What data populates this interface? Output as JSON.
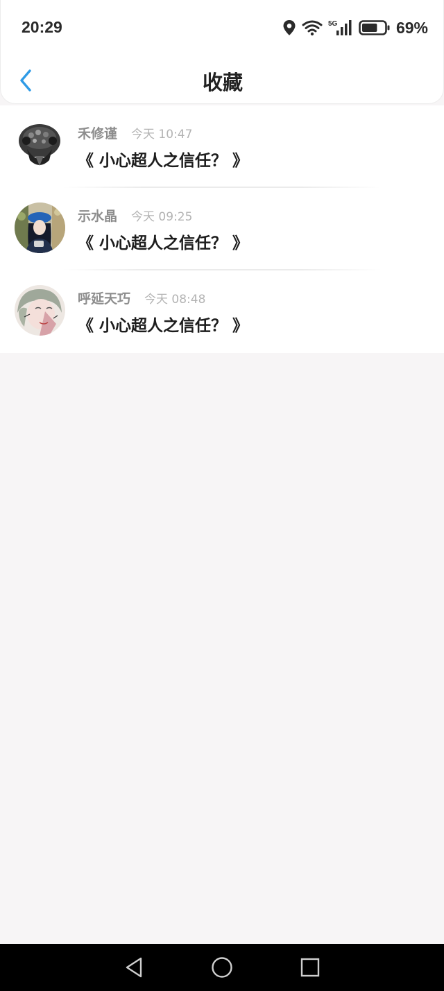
{
  "status_bar": {
    "time": "20:29",
    "network_label": "5G",
    "battery_percent": "69%",
    "battery_level": 0.69,
    "icons": [
      "location-icon",
      "wifi-icon",
      "cellular-signal-icon",
      "battery-icon"
    ]
  },
  "header": {
    "title": "收藏",
    "back_icon": "chevron-left-icon",
    "accent_color": "#2f9be6"
  },
  "favorites": [
    {
      "author": "禾修谨",
      "time": "今天 10:47",
      "title": "《 小心超人之信任？ 》",
      "avatar": "dark-ring-avatar"
    },
    {
      "author": "示水晶",
      "time": "今天 09:25",
      "title": "《 小心超人之信任？ 》",
      "avatar": "girl-blue-hat-avatar"
    },
    {
      "author": "呼延天巧",
      "time": "今天 08:48",
      "title": "《 小心超人之信任？ 》",
      "avatar": "illustrated-girl-avatar"
    }
  ],
  "nav_bar": {
    "icons": [
      "back-triangle-icon",
      "home-circle-icon",
      "recents-square-icon"
    ]
  }
}
